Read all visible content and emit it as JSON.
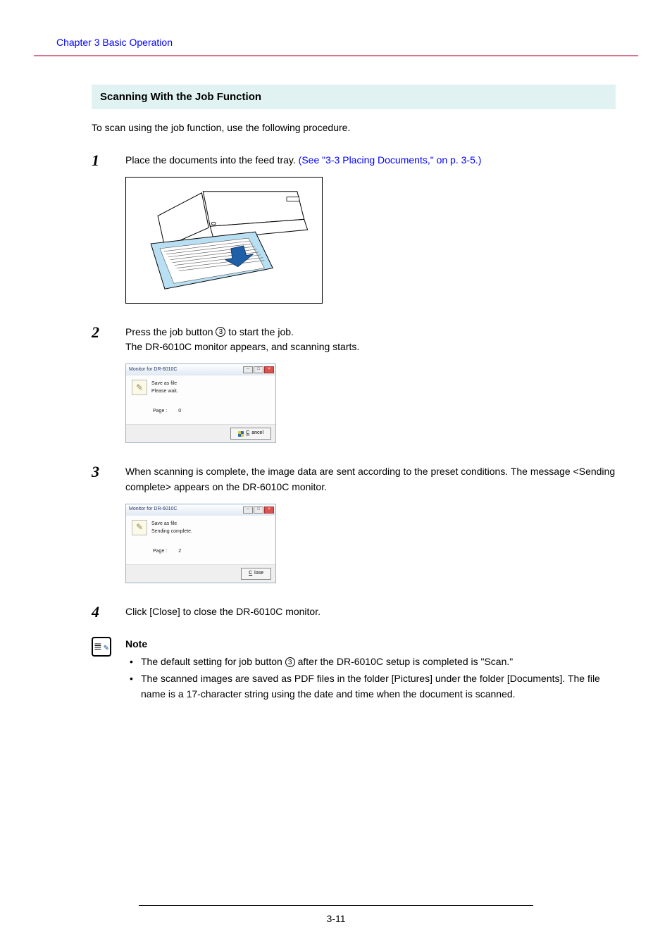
{
  "header": {
    "chapter": "Chapter 3   Basic Operation"
  },
  "section": {
    "title": "Scanning With the Job Function",
    "intro": "To scan using the job function, use the following procedure."
  },
  "steps": {
    "s1": {
      "num": "1",
      "text_a": "Place the documents into the feed tray. ",
      "link": "(See \"3-3 Placing Documents,\" on p. 3-5.)"
    },
    "s2": {
      "num": "2",
      "text_a": "Press the job button ",
      "circled": "3",
      "text_b": " to start the job.",
      "text_c": "The DR-6010C monitor appears, and scanning starts."
    },
    "s3": {
      "num": "3",
      "text_a": "When scanning is complete, the image data are sent according to the preset conditions. The message <Sending complete> appears on the DR-6010C monitor."
    },
    "s4": {
      "num": "4",
      "text_a": "Click [Close] to close the DR-6010C monitor."
    }
  },
  "dialog1": {
    "title": "Monitor for DR-6010C",
    "msg1": "Save as file",
    "msg2": "Please wait.",
    "page_label": "Page :",
    "page_value": "0",
    "button": "Cancel"
  },
  "dialog2": {
    "title": "Monitor for DR-6010C",
    "msg1": "Save as file",
    "msg2": "Sending complete.",
    "page_label": "Page :",
    "page_value": "2",
    "button": "Close"
  },
  "note": {
    "label": "Note",
    "bullet1_a": "The default setting for job button ",
    "bullet1_circled": "3",
    "bullet1_b": " after the DR-6010C setup is completed is \"Scan.\"",
    "bullet2": "The scanned images are saved as PDF files in the folder [Pictures] under the folder [Documents]. The file name is a 17-character string using the date and time when the document is scanned."
  },
  "footer": {
    "page": "3-11"
  }
}
